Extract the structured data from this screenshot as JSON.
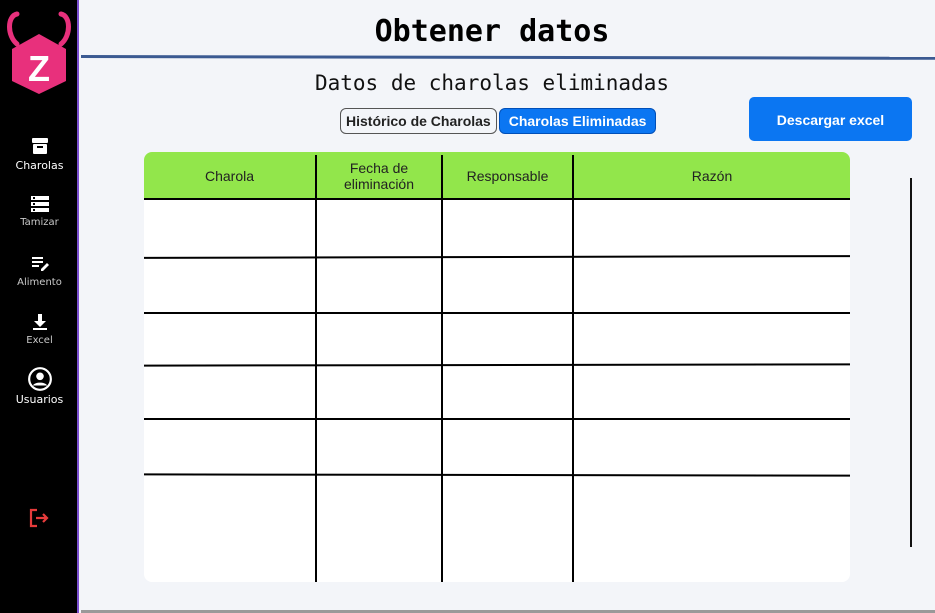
{
  "sidebar": {
    "logo_letter": "Z",
    "items": [
      {
        "label": "Charolas",
        "icon": "archive-box-icon"
      },
      {
        "label": "Tamizar",
        "icon": "server-list-icon"
      },
      {
        "label": "Alimento",
        "icon": "edit-list-icon"
      },
      {
        "label": "Excel",
        "icon": "download-icon"
      },
      {
        "label": "Usuarios",
        "icon": "user-circle-icon"
      }
    ],
    "logout_icon": "logout-icon"
  },
  "header": {
    "title": "Obtener datos",
    "subtitle": "Datos de charolas eliminadas"
  },
  "tabs": [
    {
      "label": "Histórico de Charolas",
      "active": false
    },
    {
      "label": "Charolas Eliminadas",
      "active": true
    }
  ],
  "actions": {
    "download_excel_label": "Descargar excel"
  },
  "table": {
    "columns": [
      "Charola",
      "Fecha de eliminación",
      "Responsable",
      "Razón"
    ],
    "rows": [
      [
        "",
        "",
        "",
        ""
      ],
      [
        "",
        "",
        "",
        ""
      ],
      [
        "",
        "",
        "",
        ""
      ],
      [
        "",
        "",
        "",
        ""
      ],
      [
        "",
        "",
        "",
        ""
      ],
      [
        "",
        "",
        "",
        ""
      ]
    ]
  },
  "colors": {
    "sidebar_bg": "#000000",
    "accent_blue": "#0b76f2",
    "header_green": "#92e64b",
    "logo_pink": "#e8307c",
    "logout_red": "#e53b3b"
  }
}
